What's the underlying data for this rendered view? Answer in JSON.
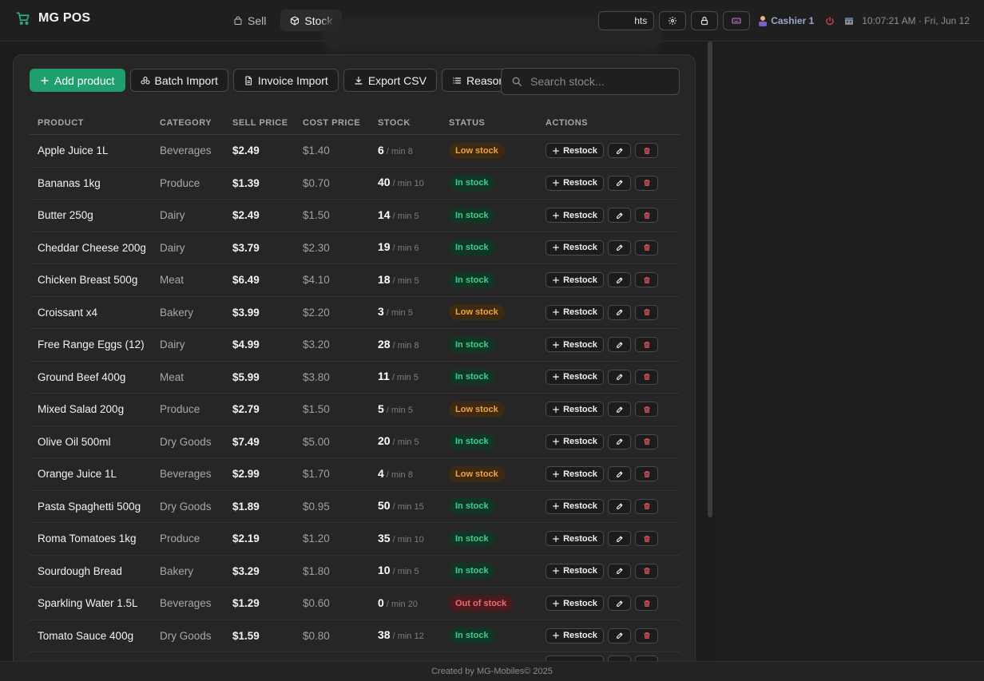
{
  "app": {
    "title": "MG POS"
  },
  "nav": {
    "tabs": [
      {
        "label": "Sell"
      },
      {
        "label": "Stock"
      }
    ]
  },
  "topbar": {
    "partial_button_label": "hts",
    "cashier": "Cashier 1",
    "datetime": "10:07:21 AM · Fri, Jun 12"
  },
  "toolbar": {
    "add": "Add product",
    "batch": "Batch Import",
    "invoice": "Invoice Import",
    "export": "Export CSV",
    "reasons": "Reasons"
  },
  "search": {
    "placeholder": "Search stock..."
  },
  "table": {
    "headers": [
      "PRODUCT",
      "CATEGORY",
      "SELL PRICE",
      "COST PRICE",
      "STOCK",
      "STATUS",
      "ACTIONS"
    ],
    "restock_label": "Restock",
    "rows": [
      {
        "product": "Apple Juice 1L",
        "category": "Beverages",
        "sell": "$2.49",
        "cost": "$1.40",
        "qty": "6",
        "min": "/ min 8",
        "status": "Low stock",
        "level": "low"
      },
      {
        "product": "Bananas 1kg",
        "category": "Produce",
        "sell": "$1.39",
        "cost": "$0.70",
        "qty": "40",
        "min": "/ min 10",
        "status": "In stock",
        "level": "in"
      },
      {
        "product": "Butter 250g",
        "category": "Dairy",
        "sell": "$2.49",
        "cost": "$1.50",
        "qty": "14",
        "min": "/ min 5",
        "status": "In stock",
        "level": "in"
      },
      {
        "product": "Cheddar Cheese 200g",
        "category": "Dairy",
        "sell": "$3.79",
        "cost": "$2.30",
        "qty": "19",
        "min": "/ min 6",
        "status": "In stock",
        "level": "in"
      },
      {
        "product": "Chicken Breast 500g",
        "category": "Meat",
        "sell": "$6.49",
        "cost": "$4.10",
        "qty": "18",
        "min": "/ min 5",
        "status": "In stock",
        "level": "in"
      },
      {
        "product": "Croissant x4",
        "category": "Bakery",
        "sell": "$3.99",
        "cost": "$2.20",
        "qty": "3",
        "min": "/ min 5",
        "status": "Low stock",
        "level": "low"
      },
      {
        "product": "Free Range Eggs (12)",
        "category": "Dairy",
        "sell": "$4.99",
        "cost": "$3.20",
        "qty": "28",
        "min": "/ min 8",
        "status": "In stock",
        "level": "in"
      },
      {
        "product": "Ground Beef 400g",
        "category": "Meat",
        "sell": "$5.99",
        "cost": "$3.80",
        "qty": "11",
        "min": "/ min 5",
        "status": "In stock",
        "level": "in"
      },
      {
        "product": "Mixed Salad 200g",
        "category": "Produce",
        "sell": "$2.79",
        "cost": "$1.50",
        "qty": "5",
        "min": "/ min 5",
        "status": "Low stock",
        "level": "low"
      },
      {
        "product": "Olive Oil 500ml",
        "category": "Dry Goods",
        "sell": "$7.49",
        "cost": "$5.00",
        "qty": "20",
        "min": "/ min 5",
        "status": "In stock",
        "level": "in"
      },
      {
        "product": "Orange Juice 1L",
        "category": "Beverages",
        "sell": "$2.99",
        "cost": "$1.70",
        "qty": "4",
        "min": "/ min 8",
        "status": "Low stock",
        "level": "low"
      },
      {
        "product": "Pasta Spaghetti 500g",
        "category": "Dry Goods",
        "sell": "$1.89",
        "cost": "$0.95",
        "qty": "50",
        "min": "/ min 15",
        "status": "In stock",
        "level": "in"
      },
      {
        "product": "Roma Tomatoes 1kg",
        "category": "Produce",
        "sell": "$2.19",
        "cost": "$1.20",
        "qty": "35",
        "min": "/ min 10",
        "status": "In stock",
        "level": "in"
      },
      {
        "product": "Sourdough Bread",
        "category": "Bakery",
        "sell": "$3.29",
        "cost": "$1.80",
        "qty": "10",
        "min": "/ min 5",
        "status": "In stock",
        "level": "in"
      },
      {
        "product": "Sparkling Water 1.5L",
        "category": "Beverages",
        "sell": "$1.29",
        "cost": "$0.60",
        "qty": "0",
        "min": "/ min 20",
        "status": "Out of stock",
        "level": "out"
      },
      {
        "product": "Tomato Sauce 400g",
        "category": "Dry Goods",
        "sell": "$1.59",
        "cost": "$0.80",
        "qty": "38",
        "min": "/ min 12",
        "status": "In stock",
        "level": "in"
      }
    ]
  },
  "footer": {
    "text": "Created by MG-Mobiles© 2025"
  },
  "colors": {
    "accent": "#1f9e6e",
    "low": "#f0a24a",
    "in": "#3fcf8e",
    "out": "#f16b74",
    "brand_icon": "#2bb07f"
  },
  "icons": {
    "brand": "shopping-cart-icon",
    "sell": "bag-icon",
    "stock": "box-icon",
    "settings": "gear-icon",
    "lock": "lock-icon",
    "keyboard": "keyboard-icon",
    "power": "power-icon",
    "add": "plus-icon",
    "batch": "boxes-icon",
    "invoice": "document-icon",
    "export": "download-icon",
    "reasons": "list-icon",
    "search": "search-icon",
    "edit": "edit-icon",
    "delete": "trash-icon"
  }
}
